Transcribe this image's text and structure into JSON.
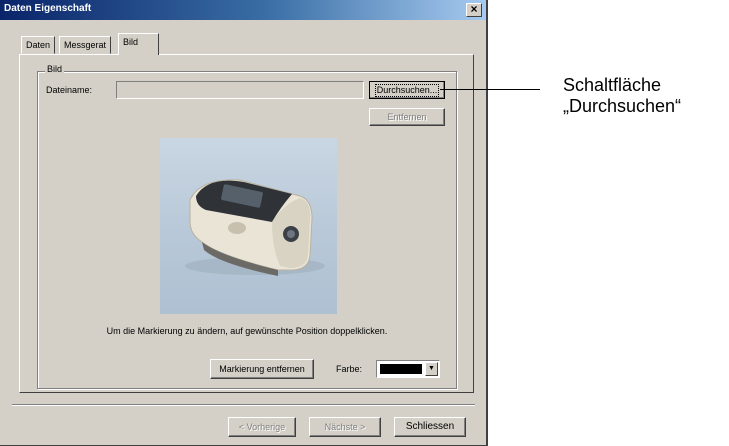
{
  "window": {
    "title": "Daten Eigenschaft",
    "close_glyph": "×"
  },
  "tabs": [
    {
      "label": "Daten",
      "active": false
    },
    {
      "label": "Messgerat",
      "active": false
    },
    {
      "label": "Bild",
      "active": true
    }
  ],
  "bild_group": {
    "legend": "Bild",
    "dateiname_label": "Dateiname:",
    "dateiname_value": "",
    "browse_label": "Durchsuchen...",
    "remove_label": "Entfernen",
    "image_icon": "device-photo",
    "hint": "Um die Markierung zu ändern, auf gewünschte Position doppelklicken.",
    "remove_marker_label": "Markierung entfernen",
    "color_label": "Farbe:",
    "color_value": "#000000"
  },
  "footer": {
    "prev_label": "< Vorherige",
    "next_label": "Nächste >",
    "close_label": "Schliessen"
  },
  "callout": {
    "line1": "Schaltfläche",
    "line2": "„Durchsuchen“"
  }
}
